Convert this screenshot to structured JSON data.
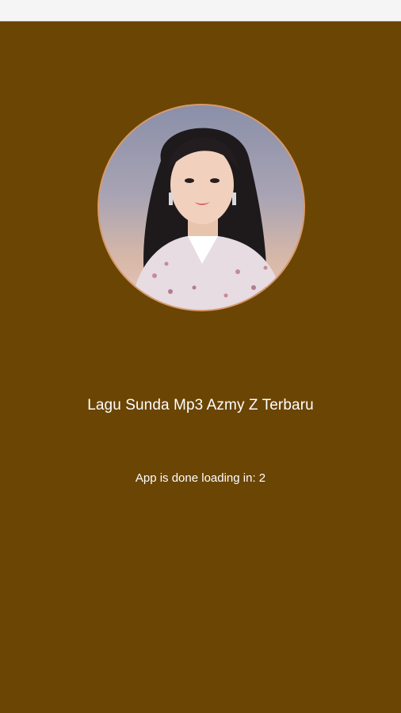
{
  "app": {
    "title": "Lagu Sunda Mp3 Azmy Z Terbaru",
    "loading_label": "App is done loading in: 2"
  },
  "colors": {
    "background": "#6b4504",
    "status_bar": "#f5f5f5",
    "avatar_border": "#d79a6e",
    "text": "#ffffff"
  },
  "avatar": {
    "icon": "artist-photo"
  }
}
